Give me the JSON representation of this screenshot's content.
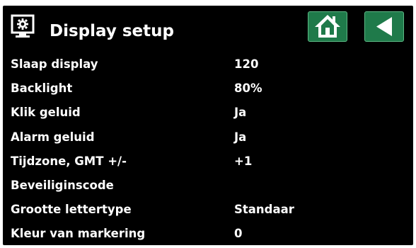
{
  "header": {
    "title": "Display setup",
    "title_icon": "monitor-gear-icon",
    "home_icon": "home-icon",
    "back_icon": "back-arrow-icon"
  },
  "colors": {
    "background": "#000000",
    "text": "#ffffff",
    "button_fill": "#1f7a4a",
    "button_border": "#5cb985"
  },
  "settings": [
    {
      "label": "Slaap display",
      "value": "120"
    },
    {
      "label": "Backlight",
      "value": "80%"
    },
    {
      "label": "Klik geluid",
      "value": "Ja"
    },
    {
      "label": "Alarm geluid",
      "value": "Ja"
    },
    {
      "label": "Tijdzone, GMT +/-",
      "value": "+1"
    },
    {
      "label": "Beveiliginscode",
      "value": ""
    },
    {
      "label": "Grootte lettertype",
      "value": "Standaar"
    },
    {
      "label": "Kleur van markering",
      "value": "0"
    }
  ]
}
